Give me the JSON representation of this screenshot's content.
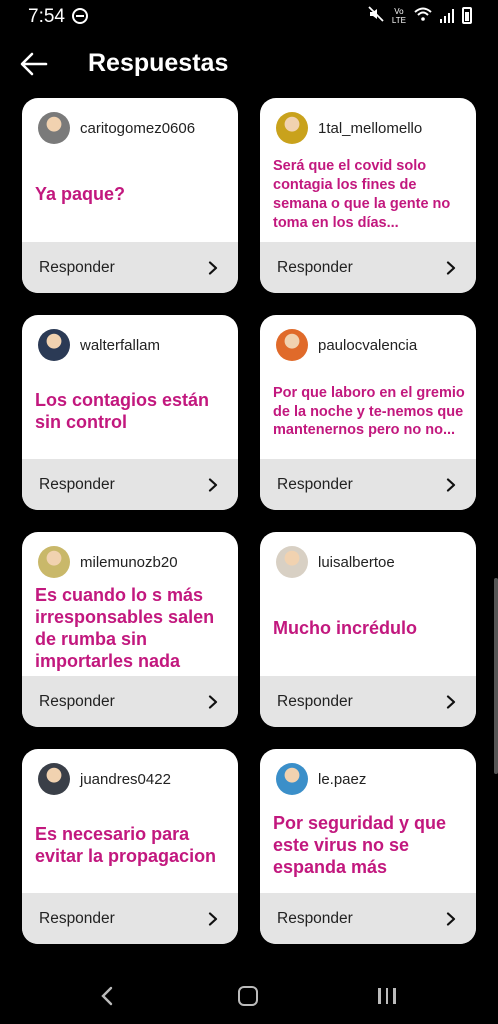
{
  "status_bar": {
    "time": "7:54",
    "volte_label": "Vo\nLTE"
  },
  "header": {
    "title": "Respuestas"
  },
  "cards": [
    {
      "username": "caritogomez0606",
      "question": "Ya paque?",
      "size": "big",
      "avatar_color": "#7a7a7a",
      "reply_label": "Responder"
    },
    {
      "username": "1tal_mellomello",
      "question": "Será que el covid solo contagia los fines de semana o que la gente no toma en los días...",
      "size": "small",
      "avatar_color": "#c9a21c",
      "reply_label": "Responder"
    },
    {
      "username": "walterfallam",
      "question": "Los contagios están sin control",
      "size": "big",
      "avatar_color": "#2b3a55",
      "reply_label": "Responder"
    },
    {
      "username": "paulocvalencia",
      "question": "Por que laboro en el gremio de la noche y te-nemos que mantenernos pero no no...",
      "size": "small",
      "avatar_color": "#e06a2a",
      "reply_label": "Responder"
    },
    {
      "username": "milemunozb20",
      "question": "Es cuando lo s más irresponsables salen de rumba sin importarles nada",
      "size": "big",
      "avatar_color": "#c9b86a",
      "reply_label": "Responder"
    },
    {
      "username": "luisalbertoe",
      "question": "Mucho incrédulo",
      "size": "big",
      "avatar_color": "#d8d0c4",
      "reply_label": "Responder"
    },
    {
      "username": "juandres0422",
      "question": "Es necesario para evitar la propagacion",
      "size": "big",
      "avatar_color": "#3a3f48",
      "reply_label": "Responder"
    },
    {
      "username": "le.paez",
      "question": "Por seguridad y que este virus no se espanda más",
      "size": "big",
      "avatar_color": "#3b8fc9",
      "reply_label": "Responder"
    }
  ],
  "colors": {
    "background": "#000000",
    "card": "#ffffff",
    "card_footer": "#e4e4e4",
    "question_text": "#c2187e"
  },
  "icons": {
    "back": "arrow-left-icon",
    "chevron": "chevron-right-icon",
    "nav_back": "nav-back-icon",
    "nav_home": "nav-home-icon",
    "nav_recent": "nav-recent-apps-icon"
  }
}
